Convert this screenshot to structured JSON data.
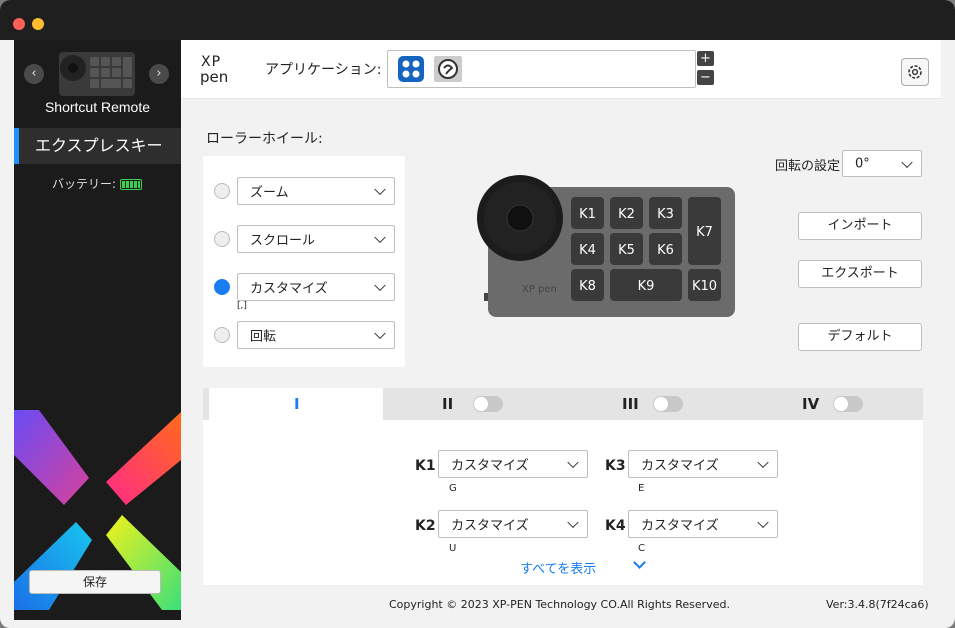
{
  "sidebar": {
    "device_name": "Shortcut Remote",
    "nav_prev": "‹",
    "nav_next": "›",
    "item_label": "エクスプレスキー",
    "battery_label": "バッテリー:",
    "battery_level": 1.0,
    "save_label": "保存"
  },
  "header": {
    "app_label": "アプリケーション:",
    "add": "+",
    "remove": "−"
  },
  "roller": {
    "title": "ローラーホイール:",
    "options": [
      {
        "label": "ズーム",
        "selected": false
      },
      {
        "label": "スクロール",
        "selected": false
      },
      {
        "label": "カスタマイズ",
        "selected": true
      },
      {
        "label": "回転",
        "selected": false
      }
    ],
    "custom_note": "[,]"
  },
  "device": {
    "brand": "XP pen",
    "keys": [
      "K1",
      "K2",
      "K3",
      "K4",
      "K5",
      "K6",
      "K7",
      "K8",
      "K9",
      "K10"
    ]
  },
  "rotation": {
    "label": "回転の設定",
    "value": "0°"
  },
  "buttons": {
    "import": "インポート",
    "export": "エクスポート",
    "default": "デフォルト"
  },
  "tabs": [
    {
      "label": "I",
      "active": true
    },
    {
      "label": "II",
      "enabled": false
    },
    {
      "label": "III",
      "enabled": false
    },
    {
      "label": "IV",
      "enabled": false
    }
  ],
  "key_settings": [
    {
      "key": "K1",
      "value": "カスタマイズ",
      "shortcut": "G"
    },
    {
      "key": "K3",
      "value": "カスタマイズ",
      "shortcut": "E"
    },
    {
      "key": "K2",
      "value": "カスタマイズ",
      "shortcut": "U"
    },
    {
      "key": "K4",
      "value": "カスタマイズ",
      "shortcut": "C"
    }
  ],
  "show_all": "すべてを表示",
  "footer": {
    "copyright": "Copyright © 2023  XP-PEN Technology CO.All Rights Reserved.",
    "version": "Ver:3.4.8(7f24ca6)"
  },
  "colors": {
    "accent": "#1a7ef2",
    "sidebar_bg": "#1b1b1b",
    "battery": "#3ccf4e"
  }
}
